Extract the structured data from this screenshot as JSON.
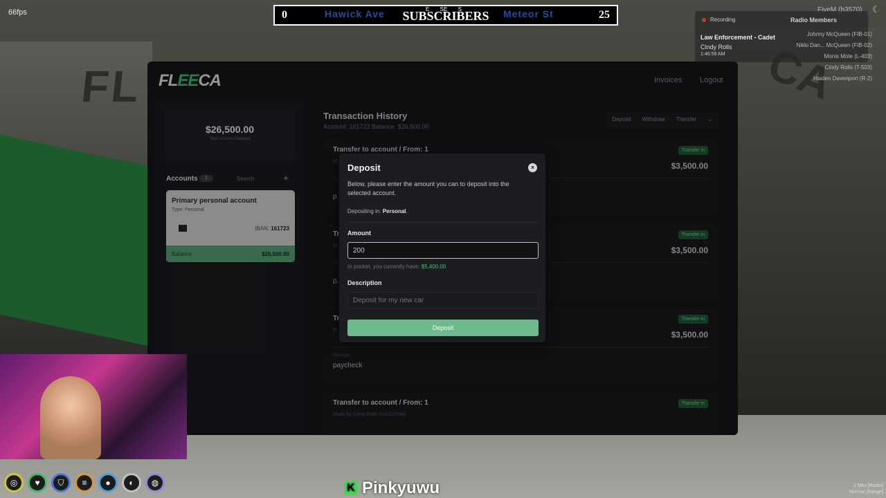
{
  "overlay": {
    "fps": "66fps",
    "score_left": "0",
    "score_right": "25",
    "street_left": "Hawick Ave",
    "street_right": "Meteor St",
    "subscribers_title": "SUBSCRIBERS",
    "compass": [
      "E",
      "SE",
      "S"
    ],
    "server_tag": "FiveM (b3570)",
    "recording_label": "Recording",
    "job": "Law Enforcement - Cadet",
    "player_name": "Cindy Rolls",
    "clock": "1:46:59 AM",
    "radio_title": "Radio Members",
    "radio_members": [
      "Johnny McQueen (FIB-01)",
      "Nikki Dan... McQueen (FIB-02)",
      "Monis Mote (L-403)",
      "Cindy Rolls (T-503)",
      "Haiden Davenport (R-2)"
    ],
    "streamer_name": "Pinkyuwu",
    "radio_freq": "1 Mhz [Radio]",
    "radio_mode": "Normal [Range]"
  },
  "scene": {
    "sign_left": "FL",
    "sign_right": "CA"
  },
  "app": {
    "logo_prefix": "FL",
    "logo_mid": "EE",
    "logo_suffix": "CA",
    "nav": [
      "Invoices",
      "Logout"
    ],
    "total_balance": "$26,500.00",
    "total_balance_label": "Total Account Balance",
    "accounts_title": "Accounts",
    "accounts_count": "1",
    "accounts_search_placeholder": "Search",
    "account": {
      "name": "Primary personal account",
      "type": "Type: Personal",
      "iban_label": "IBAN:",
      "iban": "161723",
      "balance_label": "Balance",
      "balance": "$26,500.00"
    },
    "history_title": "Transaction History",
    "history_sub": "Account: 161723   Balance: $26,500.00",
    "actions": [
      "Deposit",
      "Withdraw",
      "Transfer"
    ],
    "transactions": [
      {
        "title": "Transfer to account / From: 1",
        "badge": "Transfer in",
        "amount": "$3,500.00",
        "by": "M...",
        "message_label": "",
        "message": "p..."
      },
      {
        "title": "Tr...",
        "badge": "Transfer in",
        "amount": "$3,500.00",
        "by": "M... 22...",
        "message_label": "",
        "message": "p..."
      },
      {
        "title": "Tr...",
        "badge": "Transfer in",
        "amount": "$3,500.00",
        "by": "M... 23...",
        "message_label": "Message",
        "message": "paycheck"
      },
      {
        "title": "Transfer to account / From: 1",
        "badge": "Transfer in",
        "amount": "$3,500.00",
        "by": "Made by Cindy Rolls (HAO16784)",
        "message_label": "",
        "message": ""
      }
    ]
  },
  "modal": {
    "title": "Deposit",
    "description": "Below, please enter the amount you can to deposit into the selected account.",
    "depositing_prefix": "Depositing in:",
    "depositing_account": "Personal",
    "amount_label": "Amount",
    "amount_value": "200",
    "pocket_prefix": "In pocket, you currently have:",
    "pocket_amount": "$5,400.00",
    "description_label": "Description",
    "description_value": "Deposit for my new car",
    "submit_label": "Deposit"
  },
  "colors": {
    "brand_green": "#38c172",
    "button_green": "#6fba8c",
    "badge_green": "#1f5a37",
    "panel_dark": "#15161a"
  }
}
